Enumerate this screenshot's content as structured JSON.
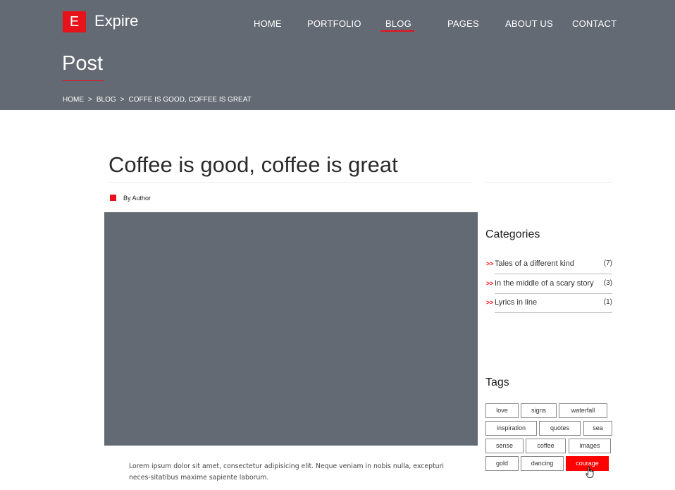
{
  "brand": {
    "logo_letter": "E",
    "name": "Expire"
  },
  "nav": [
    {
      "label": "HOME"
    },
    {
      "label": "PORTFOLIO"
    },
    {
      "label": "BLOG"
    },
    {
      "label": "PAGES"
    },
    {
      "label": "ABOUT US"
    },
    {
      "label": "CONTACT"
    }
  ],
  "nav_active": "BLOG",
  "page_title": "Post",
  "breadcrumb": {
    "items": [
      "HOME",
      "BLOG",
      "COFFE IS GOOD, COFFEE IS GREAT"
    ],
    "separator": ">"
  },
  "post": {
    "title": "Coffee is good, coffee is great",
    "author": "By Author",
    "excerpt": "Lorem ipsum dolor sit amet, consectetur adipisicing elit. Neque veniam in nobis nulla, excepturi neces-sitatibus maxime sapiente laborum."
  },
  "sidebar": {
    "categories_heading": "Categories",
    "category_marker": ">>",
    "categories": [
      {
        "label": "Tales of a different kind",
        "count": "(7)"
      },
      {
        "label": "In the middle of a scary story",
        "count": "(3)"
      },
      {
        "label": "Lyrics in line",
        "count": "(1)"
      }
    ],
    "tags_heading": "Tags",
    "tags": [
      "love",
      "signs",
      "waterfall",
      "inspiration",
      "quotes",
      "sea",
      "sense",
      "coffee",
      "images",
      "gold",
      "dancing",
      "courage"
    ],
    "active_tag": "courage"
  },
  "colors": {
    "header_bg": "#646a73",
    "accent": "#e8121a",
    "image_placeholder": "#646a73"
  }
}
